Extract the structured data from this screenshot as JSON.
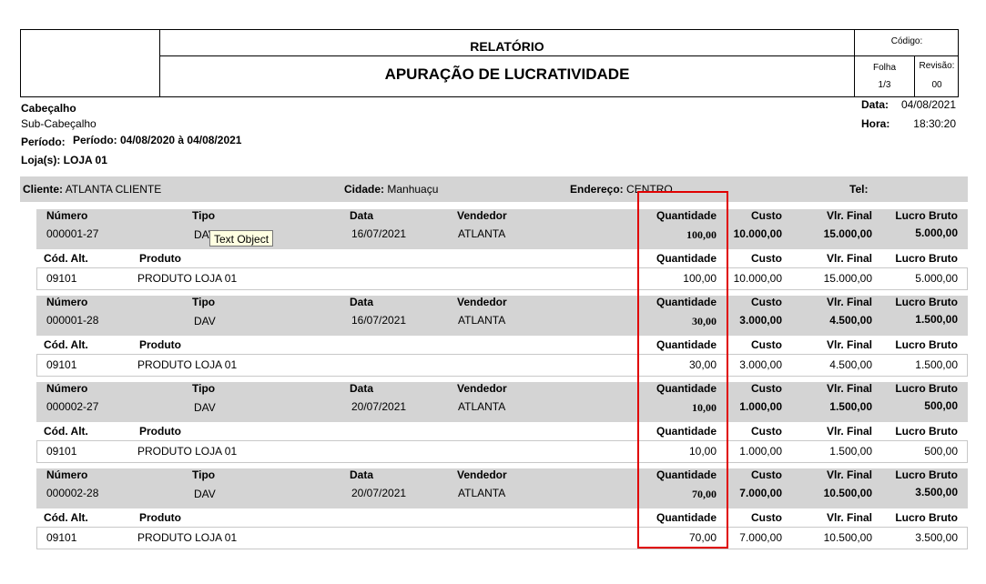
{
  "report": {
    "category": "RELATÓRIO",
    "title": "APURAÇÃO DE LUCRATIVIDADE",
    "codigo_label": "Código:",
    "folha_label": "Folha",
    "folha_value": "1/3",
    "revisao_label": "Revisão:",
    "revisao_value": "00"
  },
  "info": {
    "cabecalho": "Cabeçalho",
    "subcabecalho": "Sub-Cabeçalho",
    "periodo_label": "Período:",
    "periodo_value": "Período: 04/08/2020 à 04/08/2021",
    "lojas": "Loja(s): LOJA 01",
    "data_label": "Data:",
    "data_value": "04/08/2021",
    "hora_label": "Hora:",
    "hora_value": "18:30:20"
  },
  "client": {
    "cliente_label": "Cliente:",
    "cliente_value": "ATLANTA CLIENTE",
    "cidade_label": "Cidade:",
    "cidade_value": "Manhuaçu",
    "endereco_label": "Endereço:",
    "endereco_value": "CENTRO",
    "tel_label": "Tel:"
  },
  "labels": {
    "numero": "Número",
    "tipo": "Tipo",
    "data": "Data",
    "vendedor": "Vendedor",
    "quantidade": "Quantidade",
    "custo": "Custo",
    "vlr_final": "Vlr. Final",
    "lucro_bruto": "Lucro Bruto",
    "cod_alt": "Cód. Alt.",
    "produto": "Produto"
  },
  "tooltip": "Text Object",
  "orders": [
    {
      "numero": "000001-27",
      "tipo": "DAV",
      "data": "16/07/2021",
      "vendedor": "ATLANTA",
      "quantidade": "100,00",
      "custo": "10.000,00",
      "vlr_final": "15.000,00",
      "lucro_bruto": "5.000,00",
      "item": {
        "cod_alt": "09101",
        "produto": "PRODUTO LOJA 01",
        "quantidade": "100,00",
        "custo": "10.000,00",
        "vlr_final": "15.000,00",
        "lucro_bruto": "5.000,00"
      }
    },
    {
      "numero": "000001-28",
      "tipo": "DAV",
      "data": "16/07/2021",
      "vendedor": "ATLANTA",
      "quantidade": "30,00",
      "custo": "3.000,00",
      "vlr_final": "4.500,00",
      "lucro_bruto": "1.500,00",
      "item": {
        "cod_alt": "09101",
        "produto": "PRODUTO LOJA 01",
        "quantidade": "30,00",
        "custo": "3.000,00",
        "vlr_final": "4.500,00",
        "lucro_bruto": "1.500,00"
      }
    },
    {
      "numero": "000002-27",
      "tipo": "DAV",
      "data": "20/07/2021",
      "vendedor": "ATLANTA",
      "quantidade": "10,00",
      "custo": "1.000,00",
      "vlr_final": "1.500,00",
      "lucro_bruto": "500,00",
      "item": {
        "cod_alt": "09101",
        "produto": "PRODUTO LOJA 01",
        "quantidade": "10,00",
        "custo": "1.000,00",
        "vlr_final": "1.500,00",
        "lucro_bruto": "500,00"
      }
    },
    {
      "numero": "000002-28",
      "tipo": "DAV",
      "data": "20/07/2021",
      "vendedor": "ATLANTA",
      "quantidade": "70,00",
      "custo": "7.000,00",
      "vlr_final": "10.500,00",
      "lucro_bruto": "3.500,00",
      "item": {
        "cod_alt": "09101",
        "produto": "PRODUTO LOJA 01",
        "quantidade": "70,00",
        "custo": "7.000,00",
        "vlr_final": "10.500,00",
        "lucro_bruto": "3.500,00"
      }
    }
  ]
}
